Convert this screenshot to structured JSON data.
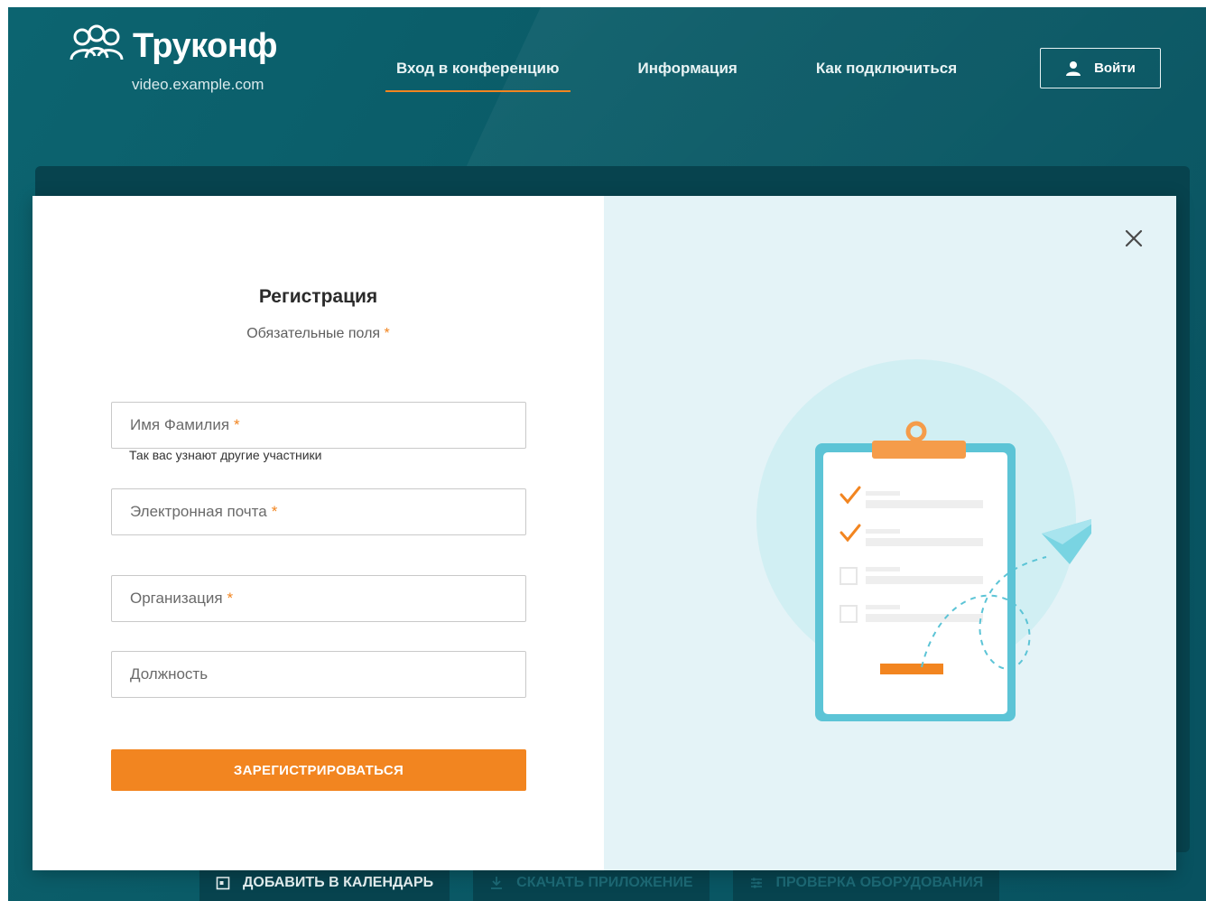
{
  "header": {
    "logo_text": "Труконф",
    "domain": "video.example.com",
    "nav": [
      {
        "label": "Вход в конференцию",
        "active": true
      },
      {
        "label": "Информация",
        "active": false
      },
      {
        "label": "Как подключиться",
        "active": false
      }
    ],
    "login_label": "Войти"
  },
  "bottom_actions": [
    {
      "label": "Добавить в календарь",
      "icon": "calendar-icon"
    },
    {
      "label": "Скачать приложение",
      "icon": "download-icon"
    },
    {
      "label": "Проверка оборудования",
      "icon": "equalizer-icon"
    }
  ],
  "modal": {
    "title": "Регистрация",
    "subtitle": "Обязательные поля",
    "required_mark": "*",
    "fields": [
      {
        "placeholder": "Имя Фамилия",
        "required": true,
        "hint": "Так вас узнают другие участники"
      },
      {
        "placeholder": "Электронная почта",
        "required": true
      },
      {
        "placeholder": "Организация",
        "required": true
      },
      {
        "placeholder": "Должность",
        "required": false
      }
    ],
    "submit_label": "ЗАРЕГИСТРИРОВАТЬСЯ",
    "close_icon": "close-icon"
  },
  "colors": {
    "brand_teal": "#0a5a66",
    "accent_orange": "#f28520",
    "panel_light": "#e4f3f7"
  }
}
